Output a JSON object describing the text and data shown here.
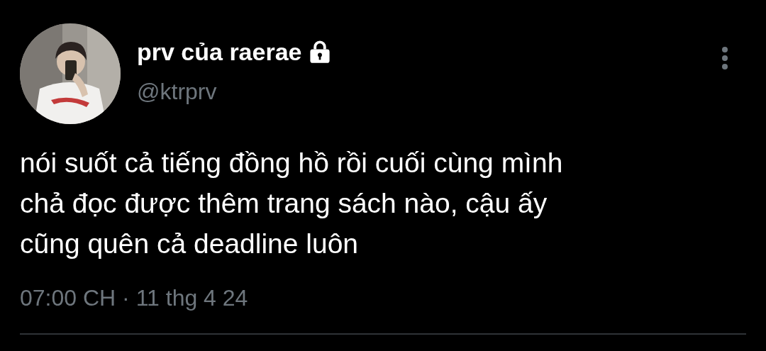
{
  "tweet": {
    "display_name": "prv của raerae",
    "protected": true,
    "handle": "@ktrprv",
    "text": "nói suốt cả tiếng đồng hồ rồi cuối cùng mình\nchả đọc được thêm trang sách nào, cậu ấy\ncũng quên cả deadline luôn",
    "timestamp": "07:00 CH · 11 thg 4 24"
  }
}
